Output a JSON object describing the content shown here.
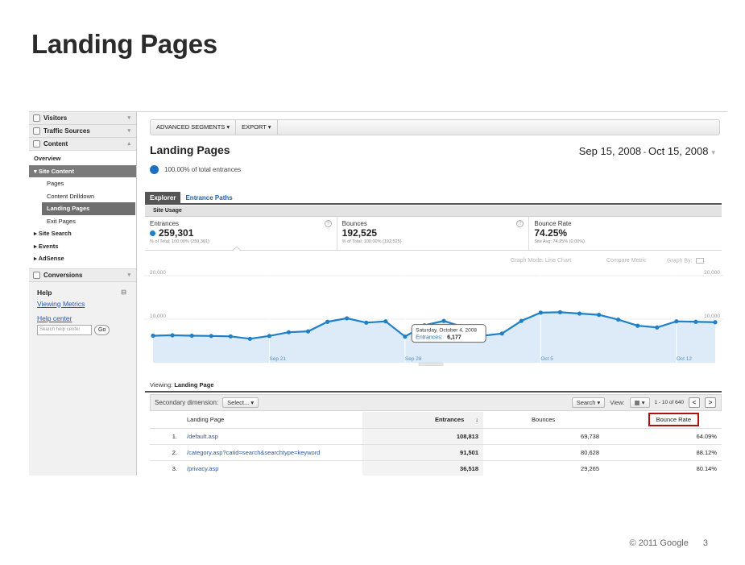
{
  "slide": {
    "title": "Landing Pages",
    "footer_copyright": "© 2011 Google",
    "page_number": "3"
  },
  "sidebar": {
    "sections": [
      {
        "label": "Visitors",
        "icon": "visitors-icon"
      },
      {
        "label": "Traffic Sources",
        "icon": "traffic-sources-icon"
      },
      {
        "label": "Content",
        "icon": "content-icon"
      }
    ],
    "content_items": {
      "overview": "Overview",
      "site_content": "▾ Site Content",
      "pages": "Pages",
      "content_drilldown": "Content Drilldown",
      "landing_pages": "Landing Pages",
      "exit_pages": "Exit Pages",
      "site_search": "▸ Site Search",
      "events": "▸ Events",
      "adsense": "▸ AdSense"
    },
    "conversions": "Conversions",
    "help": {
      "title": "Help",
      "viewing_metrics": "Viewing Metrics",
      "help_center": "Help center",
      "search_placeholder": "Search help center",
      "go": "Go"
    }
  },
  "toolbar": {
    "advanced_segments": "ADVANCED SEGMENTS ▾",
    "export": "EXPORT ▾"
  },
  "header": {
    "title": "Landing Pages",
    "date_start": "Sep 15, 2008",
    "date_sep": " - ",
    "date_end": "Oct 15, 2008",
    "percent_label": "100.00% of total entrances"
  },
  "tabs": {
    "explorer": "Explorer",
    "entrance_paths": "Entrance Paths"
  },
  "site_usage": "Site Usage",
  "metrics": [
    {
      "label": "Entrances",
      "value": "259,301",
      "sub": "% of Total: 100.00% (259,301)"
    },
    {
      "label": "Bounces",
      "value": "192,525",
      "sub": "% of Total: 100.00% (192,525)"
    },
    {
      "label": "Bounce Rate",
      "value": "74.25%",
      "sub": "Site Avg: 74.25% (0.00%)"
    }
  ],
  "graph_controls": {
    "graph_mode": "Graph Mode:",
    "line_chart": "Line Chart",
    "compare_metric": "Compare Metric",
    "graph_by": "Graph By:"
  },
  "chart_data": {
    "type": "area",
    "y_ticks": [
      "20,000",
      "10,000"
    ],
    "x_labels": [
      "Sep 21",
      "Sep 28",
      "Oct 5",
      "Oct 12"
    ],
    "ylim": [
      0,
      20000
    ],
    "series": [
      {
        "values": [
          6200,
          6300,
          6200,
          6150,
          6050,
          5500,
          6150,
          7000,
          7200,
          9400,
          10200,
          9200,
          9500,
          6000,
          8600,
          9600,
          8200,
          6177,
          6700,
          9600,
          11500,
          11600,
          11300,
          11000,
          9900,
          8500,
          8100,
          9500,
          9400,
          9300
        ]
      }
    ],
    "tooltip": {
      "date": "Saturday, October 4, 2008",
      "label": "Entrances:",
      "value": "6,177"
    }
  },
  "accent_color": "#1f80c8",
  "viewing": {
    "label": "Viewing:",
    "value": "Landing Page"
  },
  "secondary": {
    "label": "Secondary dimension:",
    "select": "Select... ▾",
    "search": "Search ▾",
    "view": "View:",
    "pager": "1 - 10 of 640",
    "prev": "<",
    "next": ">"
  },
  "table": {
    "headers": {
      "landing_page": "Landing Page",
      "entrances": "Entrances",
      "bounces": "Bounces",
      "bounce_rate": "Bounce Rate"
    },
    "rows": [
      {
        "idx": "1.",
        "page": "/default.asp",
        "entrances": "108,813",
        "bounces": "69,738",
        "rate": "64.09%"
      },
      {
        "idx": "2.",
        "page": "/category.asp?catid=search&searchtype=keyword",
        "entrances": "91,501",
        "bounces": "80,628",
        "rate": "88.12%"
      },
      {
        "idx": "3.",
        "page": "/privacy.asp",
        "entrances": "36,518",
        "bounces": "29,265",
        "rate": "80.14%"
      }
    ]
  }
}
